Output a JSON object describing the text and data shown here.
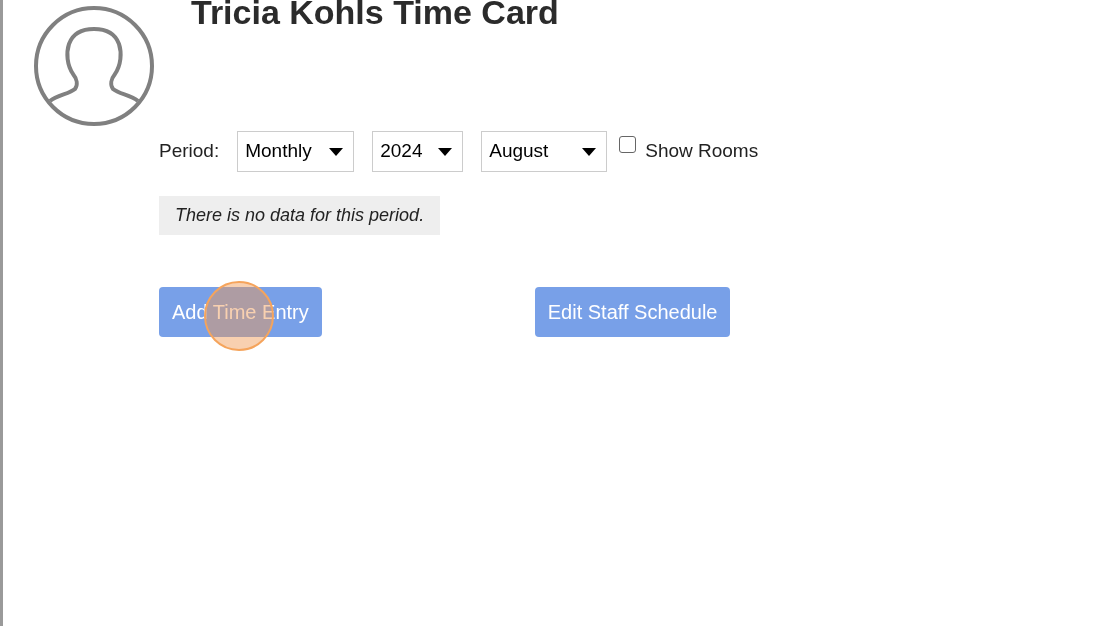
{
  "title": "Tricia Kohls Time Card",
  "period": {
    "label": "Period:",
    "selects": [
      {
        "value": "Monthly"
      },
      {
        "value": "2024"
      },
      {
        "value": "August"
      }
    ]
  },
  "show_rooms": {
    "label": "Show Rooms",
    "checked": false
  },
  "message": "There is no data for this period.",
  "buttons": [
    {
      "label": "Add Time Entry",
      "clicked": true
    },
    {
      "label": "Edit Staff Schedule",
      "clicked": false
    }
  ]
}
